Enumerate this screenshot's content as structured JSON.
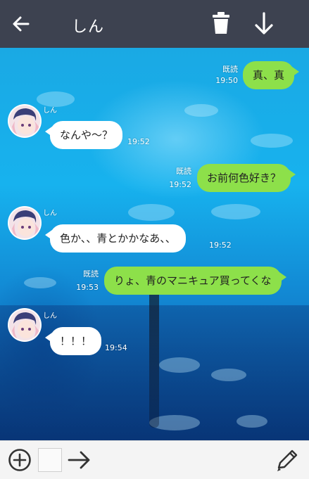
{
  "header": {
    "title": "しん"
  },
  "messages": [
    {
      "direction": "out",
      "text": "真、真",
      "read": "既読",
      "time": "19:50"
    },
    {
      "direction": "in",
      "sender": "しん",
      "text": "なんや〜？",
      "time": "19:52"
    },
    {
      "direction": "out",
      "text": "お前何色好き？",
      "read": "既読",
      "time": "19:52"
    },
    {
      "direction": "in",
      "sender": "しん",
      "text": "色か、、青とかかなあ、、",
      "time": "19:52"
    },
    {
      "direction": "out",
      "text": "りょ、青のマニキュア買ってくな",
      "read": "既読",
      "time": "19:53"
    },
    {
      "direction": "in",
      "sender": "しん",
      "text": "！！！",
      "time": "19:54"
    }
  ],
  "icons": {
    "back": "arrow-left-icon",
    "trash": "trash-icon",
    "download": "arrow-down-icon",
    "add": "plus-circle-icon",
    "send": "arrow-right-icon",
    "edit": "pencil-icon"
  },
  "colors": {
    "header_bg": "#3d4250",
    "outgoing_bubble": "#8de04a",
    "incoming_bubble": "#ffffff"
  }
}
